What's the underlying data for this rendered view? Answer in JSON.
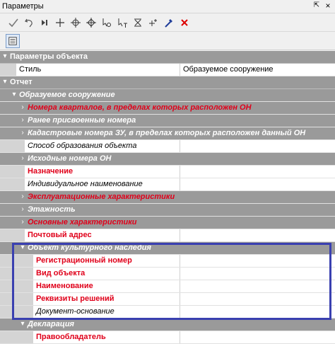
{
  "window": {
    "title": "Параметры",
    "pin_glyph": "⇱",
    "close_glyph": "×"
  },
  "toolbar": {
    "icons": [
      "check-icon",
      "undo-icon",
      "step-icon",
      "plus-icon",
      "crosshair-icon",
      "crosshair-vertex-icon",
      "select-node-icon",
      "text-cursor-icon",
      "snap-icon",
      "add-node-icon",
      "eyedropper-icon",
      "delete-icon"
    ]
  },
  "grid": {
    "rows": [
      {
        "label": "Параметры объекта",
        "type": "cat",
        "level": 0,
        "exp": "▾"
      },
      {
        "label": "Стиль",
        "value": "Образуемое сооружение",
        "type": "prop",
        "level": 1
      },
      {
        "label": "Отчет",
        "type": "cat",
        "level": 0,
        "exp": "▾"
      },
      {
        "label": "Образуемое сооружение",
        "type": "sub",
        "level": 1,
        "exp": "▾"
      },
      {
        "label": "Номера кварталов, в пределах которых расположен ОН",
        "type": "reqgrp",
        "level": 2,
        "exp": "›"
      },
      {
        "label": "Ранее присвоенные номера",
        "type": "sub",
        "level": 2,
        "exp": "›"
      },
      {
        "label": "Кадастровые номера ЗУ, в пределах которых расположен данный ОН",
        "type": "sub",
        "level": 2,
        "exp": "›"
      },
      {
        "label": "Способ образования объекта",
        "value": "",
        "type": "ital",
        "level": 2
      },
      {
        "label": "Исходные номера ОН",
        "type": "sub",
        "level": 2,
        "exp": "›"
      },
      {
        "label": "Назначение",
        "value": "",
        "type": "req",
        "level": 2
      },
      {
        "label": "Индивидуальное наименование",
        "value": "",
        "type": "ital",
        "level": 2
      },
      {
        "label": "Эксплуатационные характеристики",
        "type": "reqgrp",
        "level": 2,
        "exp": "›"
      },
      {
        "label": "Этажность",
        "type": "sub",
        "level": 2,
        "exp": "›"
      },
      {
        "label": "Основные характеристики",
        "type": "reqgrp",
        "level": 2,
        "exp": "›"
      },
      {
        "label": "Почтовый адрес",
        "value": "",
        "type": "req",
        "level": 2
      },
      {
        "label": "Объект культурного наследия",
        "type": "sub",
        "level": 2,
        "exp": "▾"
      },
      {
        "label": "Регистрационный номер",
        "value": "",
        "type": "req",
        "level": 3
      },
      {
        "label": "Вид объекта",
        "value": "",
        "type": "req",
        "level": 3
      },
      {
        "label": "Наименование",
        "value": "",
        "type": "req",
        "level": 3
      },
      {
        "label": "Реквизиты решений",
        "value": "",
        "type": "req",
        "level": 3
      },
      {
        "label": "Документ-основание",
        "value": "",
        "type": "ital",
        "level": 3
      },
      {
        "label": "Декларация",
        "type": "sub",
        "level": 2,
        "exp": "▾"
      },
      {
        "label": "Правообладатель",
        "value": "",
        "type": "req",
        "level": 3
      }
    ]
  },
  "colors": {
    "category_bg": "#9a9a9a",
    "required_text": "#e0001a",
    "highlight_border": "#3a40b0"
  }
}
